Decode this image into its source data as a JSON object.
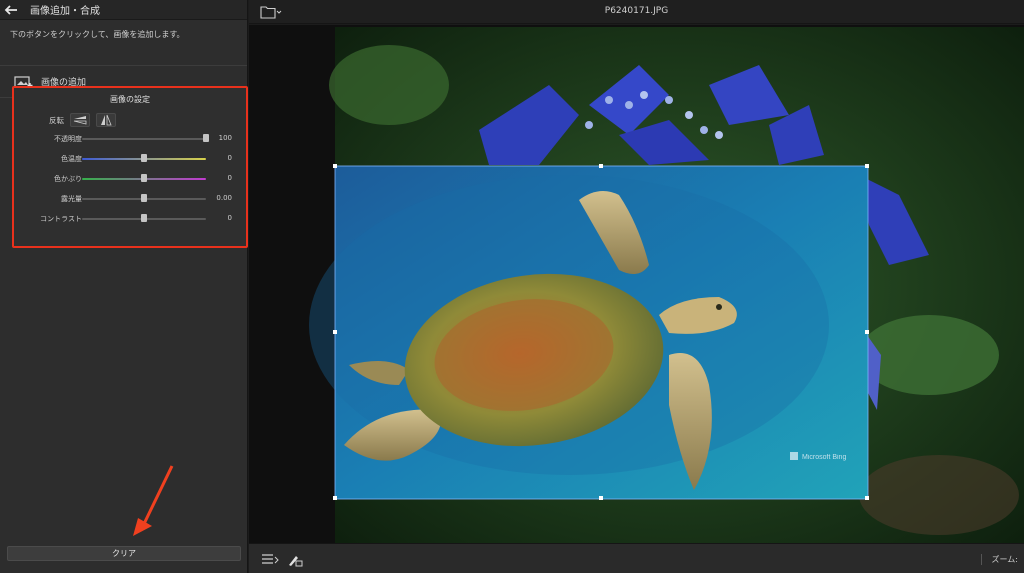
{
  "panel": {
    "title": "画像追加・合成",
    "hint": "下のボタンをクリックして、画像を追加します。",
    "add_image_label": "画像の追加",
    "settings": {
      "title": "画像の設定",
      "flip_label": "反転",
      "sliders": [
        {
          "label": "不透明度",
          "value": "100",
          "level": 1.0,
          "track": "#5a5a5a"
        },
        {
          "label": "色温度",
          "value": "0",
          "level": 0.5,
          "track": "linear-gradient(90deg,#3e5bd6,#d8d24a)"
        },
        {
          "label": "色かぶり",
          "value": "0",
          "level": 0.5,
          "track": "linear-gradient(90deg,#35b14a,#c23ad1)"
        },
        {
          "label": "露光量",
          "value": "0.00",
          "level": 0.5,
          "track": "#5a5a5a"
        },
        {
          "label": "コントラスト",
          "value": "0",
          "level": 0.5,
          "track": "#5a5a5a"
        }
      ]
    },
    "clear_label": "クリア"
  },
  "viewer": {
    "filename": "P6240171.JPG",
    "watermark": "Microsoft Bing",
    "zoom_label": "ズーム:"
  },
  "colors": {
    "highlight": "#e8311c",
    "arrow": "#f0401f"
  }
}
